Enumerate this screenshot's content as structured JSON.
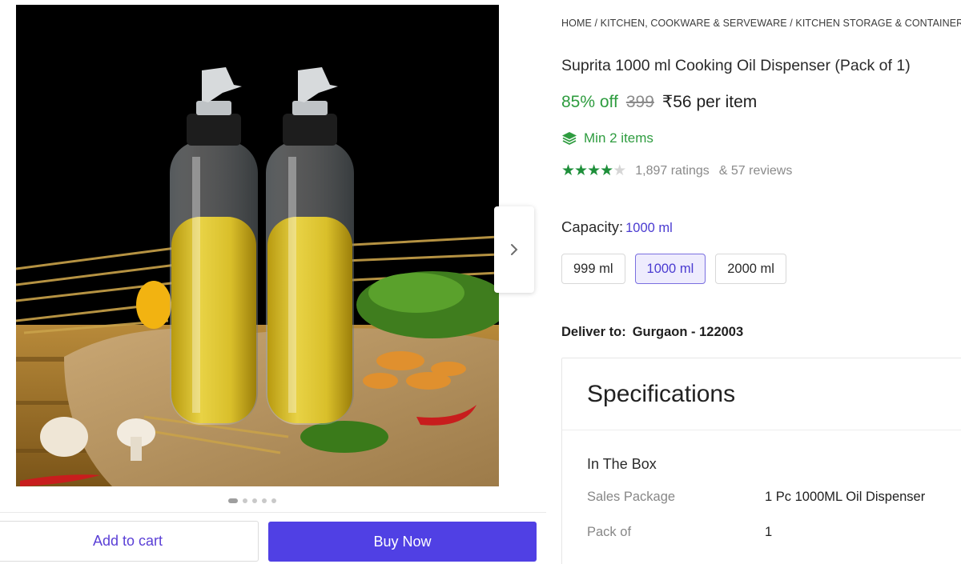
{
  "breadcrumb": {
    "home": "HOME",
    "sep": "/",
    "cat1": "KITCHEN, COOKWARE & SERVEWARE",
    "cat2": "KITCHEN STORAGE & CONTAINERS"
  },
  "product": {
    "title": "Suprita 1000 ml Cooking Oil Dispenser (Pack of 1)",
    "discount": "85% off",
    "mrp": "399",
    "price": "₹56 per item",
    "min_items": "Min 2 items",
    "rating_stars": 4,
    "ratings": "1,897 ratings",
    "reviews": "& 57 reviews"
  },
  "capacity": {
    "label": "Capacity:",
    "selected": "1000 ml",
    "options": [
      "999 ml",
      "1000 ml",
      "2000 ml"
    ]
  },
  "delivery": {
    "label": "Deliver to:",
    "pincode": "Gurgaon - 122003"
  },
  "specifications": {
    "heading": "Specifications",
    "section": "In The Box",
    "rows": [
      {
        "key": "Sales Package",
        "value": "1 Pc 1000ML Oil Dispenser"
      },
      {
        "key": "Pack of",
        "value": "1"
      }
    ]
  },
  "gallery": {
    "image_count": 5,
    "active_index": 0
  },
  "actions": {
    "add_to_cart": "Add to cart",
    "buy_now": "Buy Now"
  },
  "colors": {
    "accent": "#5040e4",
    "discount_green": "#2e9c3f",
    "star_green": "#1e8f3a"
  },
  "icons": {
    "next": "chevron-right-icon",
    "min_items": "layers-icon",
    "star": "star-icon"
  }
}
